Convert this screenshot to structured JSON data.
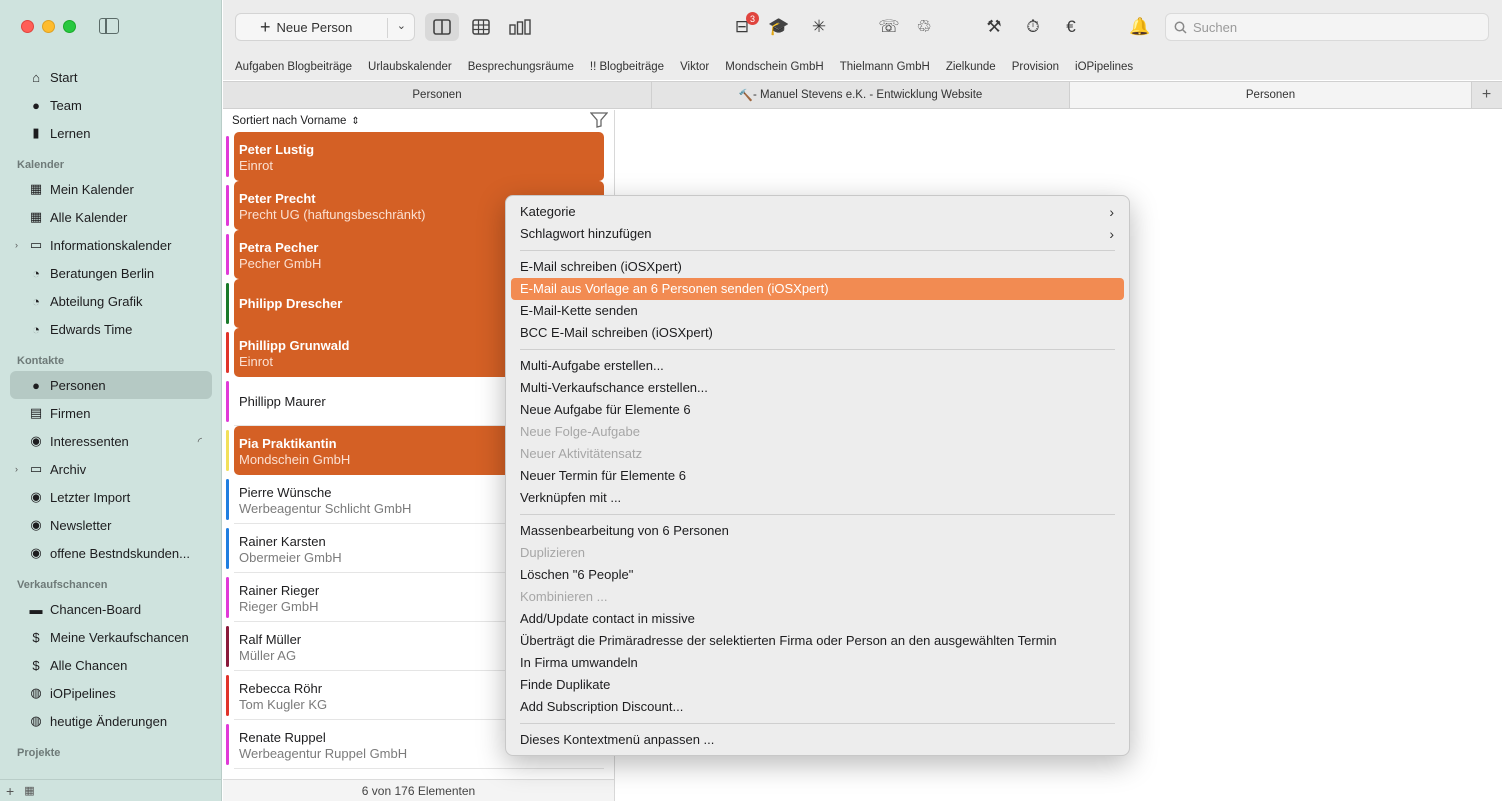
{
  "sidebar": {
    "items": [
      {
        "type": "item",
        "icon": "home-icon",
        "glyph": "⌂",
        "label": "Start"
      },
      {
        "type": "item",
        "icon": "team-icon",
        "glyph": "●",
        "label": "Team"
      },
      {
        "type": "item",
        "icon": "book-icon",
        "glyph": "▮",
        "label": "Lernen"
      },
      {
        "type": "section",
        "label": "Kalender"
      },
      {
        "type": "item",
        "icon": "calendar-icon",
        "glyph": "▦",
        "label": "Mein Kalender"
      },
      {
        "type": "item",
        "icon": "calendar-icon",
        "glyph": "▦",
        "label": "Alle Kalender"
      },
      {
        "type": "item",
        "icon": "folder-icon",
        "glyph": "▭",
        "label": "Informationskalender",
        "disclosure": true
      },
      {
        "type": "item",
        "icon": "calendar-smart-icon",
        "glyph": "◔",
        "label": "Beratungen Berlin"
      },
      {
        "type": "item",
        "icon": "calendar-smart-icon",
        "glyph": "◔",
        "label": "Abteilung Grafik"
      },
      {
        "type": "item",
        "icon": "calendar-smart-icon",
        "glyph": "◔",
        "label": "Edwards Time"
      },
      {
        "type": "section",
        "label": "Kontakte"
      },
      {
        "type": "item",
        "icon": "person-icon",
        "glyph": "●",
        "label": "Personen",
        "active": true
      },
      {
        "type": "item",
        "icon": "building-icon",
        "glyph": "▤",
        "label": "Firmen"
      },
      {
        "type": "item",
        "icon": "person-smart-icon",
        "glyph": "◉",
        "label": "Interessenten",
        "badge": true
      },
      {
        "type": "item",
        "icon": "folder-icon",
        "glyph": "▭",
        "label": "Archiv",
        "disclosure": true
      },
      {
        "type": "item",
        "icon": "person-smart-icon",
        "glyph": "◉",
        "label": "Letzter Import"
      },
      {
        "type": "item",
        "icon": "person-smart-icon",
        "glyph": "◉",
        "label": "Newsletter"
      },
      {
        "type": "item",
        "icon": "person-smart-icon",
        "glyph": "◉",
        "label": "offene Bestndskunden..."
      },
      {
        "type": "section",
        "label": "Verkaufschancen"
      },
      {
        "type": "item",
        "icon": "board-icon",
        "glyph": "▬",
        "label": "Chancen-Board"
      },
      {
        "type": "item",
        "icon": "dollar-icon",
        "glyph": "$",
        "label": "Meine Verkaufschancen"
      },
      {
        "type": "item",
        "icon": "dollar-doc-icon",
        "glyph": "$",
        "label": "Alle Chancen"
      },
      {
        "type": "item",
        "icon": "pipeline-icon",
        "glyph": "◍",
        "label": "iOPipelines"
      },
      {
        "type": "item",
        "icon": "changes-icon",
        "glyph": "◍",
        "label": "heutige Änderungen"
      },
      {
        "type": "section",
        "label": "Projekte"
      }
    ]
  },
  "toolbar": {
    "new_person": "Neue Person",
    "badge_count": "3",
    "search_placeholder": "Suchen"
  },
  "favorites": [
    "Aufgaben Blogbeiträge",
    "Urlaubskalender",
    "Besprechungsräume",
    "!! Blogbeiträge",
    "Viktor",
    "Mondschein GmbH",
    "Thielmann GmbH",
    "Zielkunde",
    "Provision",
    "iOPipelines"
  ],
  "tabs": [
    {
      "label": "Personen",
      "icon": "",
      "active": false
    },
    {
      "label": " - Manuel Stevens e.K. - Entwicklung Website",
      "icon": "🔨",
      "active": false
    },
    {
      "label": "Personen",
      "icon": "",
      "active": true
    }
  ],
  "list": {
    "sort_label": "Sortiert nach Vorname",
    "footer": "6 von 176 Elementen",
    "rows": [
      {
        "name": "Peter Lustig",
        "sub": "Einrot",
        "color": "#e03ad8",
        "selected": true
      },
      {
        "name": "Peter Precht",
        "sub": "Precht UG (haftungsbeschränkt)",
        "color": "#e03ad8",
        "selected": true
      },
      {
        "name": "Petra Pecher",
        "sub": "Pecher GmbH",
        "color": "#e03ad8",
        "selected": true
      },
      {
        "name": "Philipp Drescher",
        "sub": "",
        "color": "#1a7a2a",
        "selected": true
      },
      {
        "name": "Phillipp Grunwald",
        "sub": "Einrot",
        "color": "#e0342a",
        "selected": true
      },
      {
        "name": "Phillipp Maurer",
        "sub": "",
        "color": "#e03ad8",
        "selected": false
      },
      {
        "name": "Pia Praktikantin",
        "sub": "Mondschein GmbH",
        "color": "#f2e05a",
        "selected": true
      },
      {
        "name": "Pierre Wünsche",
        "sub": "Werbeagentur Schlicht GmbH",
        "color": "#1f7fe0",
        "selected": false
      },
      {
        "name": "Rainer Karsten",
        "sub": "Obermeier GmbH",
        "color": "#1f7fe0",
        "selected": false
      },
      {
        "name": "Rainer Rieger",
        "sub": "Rieger GmbH",
        "color": "#e03ad8",
        "selected": false
      },
      {
        "name": "Ralf Müller",
        "sub": "Müller AG",
        "color": "#8a1a3a",
        "selected": false
      },
      {
        "name": "Rebecca Röhr",
        "sub": "Tom Kugler KG",
        "color": "#e0342a",
        "selected": false
      },
      {
        "name": "Renate Ruppel",
        "sub": "Werbeagentur Ruppel GmbH",
        "color": "#e03ad8",
        "selected": false
      }
    ]
  },
  "context_menu": {
    "groups": [
      [
        {
          "label": "Kategorie",
          "sub": true
        },
        {
          "label": "Schlagwort hinzufügen",
          "sub": true
        }
      ],
      [
        {
          "label": "E-Mail schreiben (iOSXpert)"
        },
        {
          "label": "E-Mail aus Vorlage an 6 Personen senden (iOSXpert)",
          "highlight": true
        },
        {
          "label": "E-Mail-Kette senden"
        },
        {
          "label": "BCC E-Mail schreiben (iOSXpert)"
        }
      ],
      [
        {
          "label": "Multi-Aufgabe erstellen..."
        },
        {
          "label": "Multi-Verkaufschance erstellen..."
        },
        {
          "label": "Neue Aufgabe für Elemente 6"
        },
        {
          "label": "Neue Folge-Aufgabe",
          "disabled": true
        },
        {
          "label": "Neuer Aktivitätensatz",
          "disabled": true
        },
        {
          "label": "Neuer Termin für Elemente 6"
        },
        {
          "label": "Verknüpfen mit ..."
        }
      ],
      [
        {
          "label": "Massenbearbeitung von 6 Personen"
        },
        {
          "label": "Duplizieren",
          "disabled": true
        },
        {
          "label": "Löschen \"6 People\""
        },
        {
          "label": "Kombinieren ...",
          "disabled": true
        },
        {
          "label": "Add/Update contact in missive"
        },
        {
          "label": "Überträgt die Primäradresse der selektierten Firma oder Person an den  ausgewählten Termin"
        },
        {
          "label": "In Firma umwandeln"
        },
        {
          "label": "Finde Duplikate"
        },
        {
          "label": "Add Subscription Discount..."
        }
      ],
      [
        {
          "label": "Dieses Kontextmenü anpassen ..."
        }
      ]
    ]
  },
  "colors": {
    "accent": "#d46025",
    "menu_highlight": "#f28b52",
    "sidebar_bg": "#cfe3de"
  }
}
